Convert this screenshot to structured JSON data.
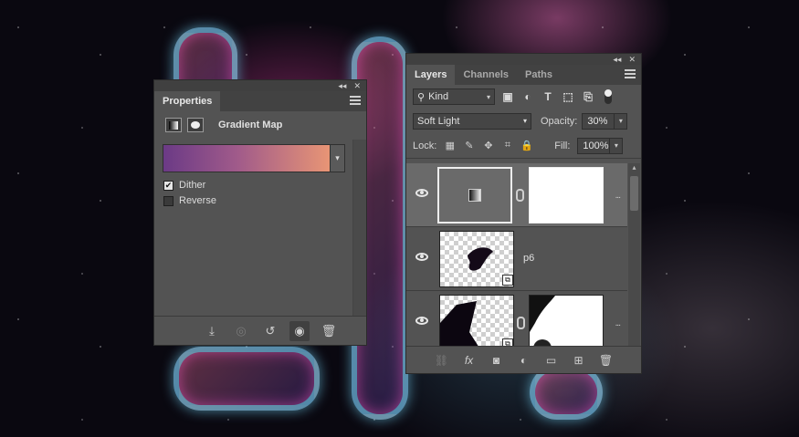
{
  "properties_panel": {
    "tab_label": "Properties",
    "title": "Gradient Map",
    "gradient_colors": [
      "#6b3a86",
      "#a15b8a",
      "#e89575"
    ],
    "options": [
      {
        "label": "Dither",
        "checked": true
      },
      {
        "label": "Reverse",
        "checked": false
      }
    ],
    "footer_icons": [
      "clip-to-layer-icon",
      "view-previous-state-icon",
      "reset-icon",
      "visibility-icon",
      "trash-icon"
    ]
  },
  "layers_panel": {
    "tabs": [
      "Layers",
      "Channels",
      "Paths"
    ],
    "filter_kind": "Kind",
    "filter_icons": [
      "pixel-filter-icon",
      "adjustment-filter-icon",
      "type-filter-icon",
      "shape-filter-icon",
      "smart-object-filter-icon"
    ],
    "blend_mode": "Soft Light",
    "opacity_label": "Opacity:",
    "opacity_value": "30%",
    "lock_label": "Lock:",
    "fill_label": "Fill:",
    "fill_value": "100%",
    "layers": [
      {
        "name": "",
        "type": "gradient-map-adjustment",
        "selected": true,
        "visible": true
      },
      {
        "name": "p6",
        "type": "smart-object",
        "selected": false,
        "visible": true
      },
      {
        "name": "",
        "type": "smart-object-with-mask",
        "selected": false,
        "visible": true
      }
    ],
    "footer_icons": [
      "link-layers-icon",
      "fx-icon",
      "add-mask-icon",
      "new-adjustment-icon",
      "new-group-icon",
      "new-layer-icon",
      "trash-icon"
    ]
  },
  "colors": {
    "panel_bg": "#535353",
    "tab_bar_bg": "#424242",
    "selected_layer_bg": "#6a6a6a"
  }
}
